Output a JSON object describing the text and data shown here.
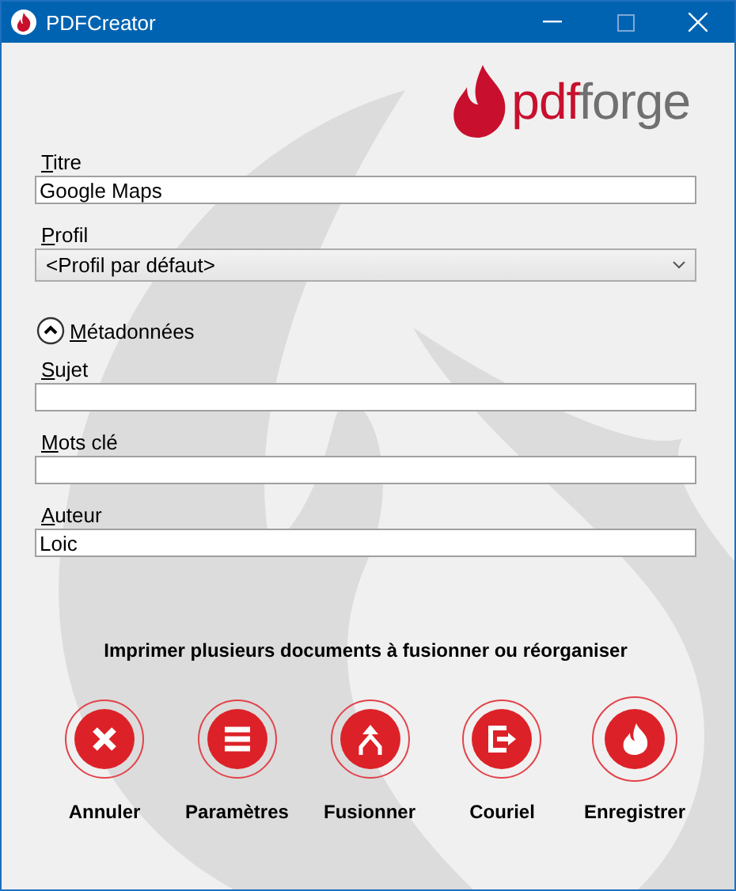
{
  "window": {
    "title": "PDFCreator"
  },
  "logo_text": [
    "pdf",
    "forge"
  ],
  "title_field": {
    "label": "Titre",
    "value": "Google Maps"
  },
  "profile": {
    "label": "Profil",
    "value": "<Profil par défaut>"
  },
  "metadata": {
    "label": "Métadonnées",
    "expanded": true,
    "fields": [
      {
        "label": "Sujet"
      },
      {
        "label": "Mots clé"
      },
      {
        "label": "Auteur",
        "value": "Loic"
      }
    ]
  },
  "message": "Imprimer plusieurs documents à fusionner ou réorganiser",
  "actions": [
    {
      "kind": "cancel",
      "label": "Annuler",
      "default": false
    },
    {
      "kind": "settings",
      "label": "Paramètres",
      "default": false
    },
    {
      "kind": "merge",
      "label": "Fusionner",
      "default": false
    },
    {
      "kind": "email",
      "label": "Couriel",
      "default": false
    },
    {
      "kind": "save",
      "label": "Enregistrer",
      "default": true
    }
  ]
}
